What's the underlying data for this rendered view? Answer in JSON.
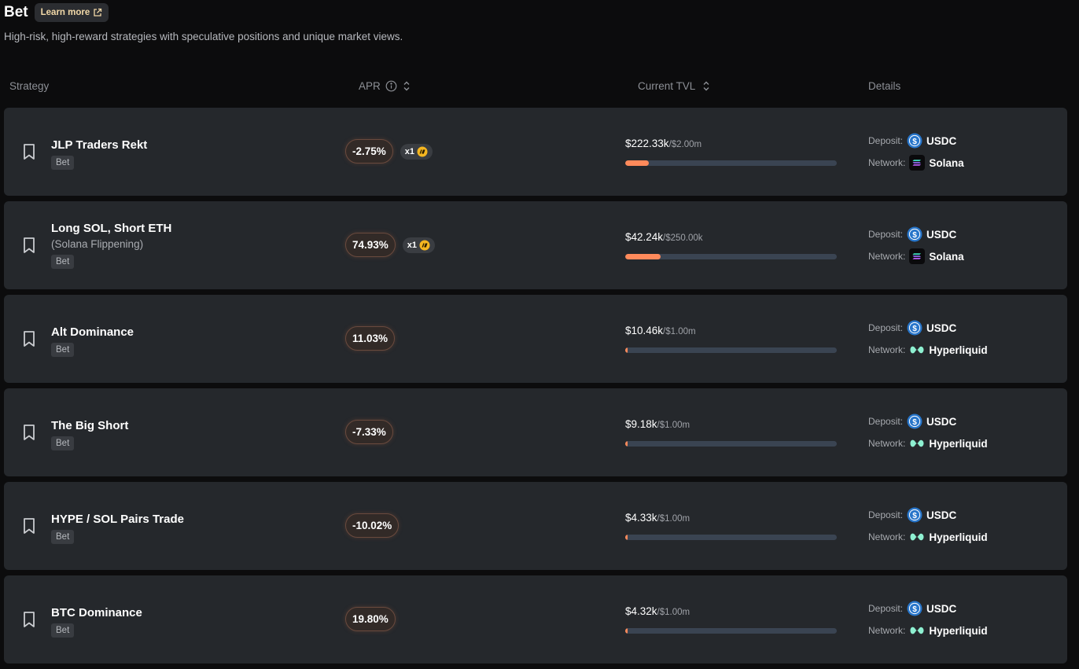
{
  "header": {
    "title": "Bet",
    "learn_more": "Learn more",
    "subtitle": "High-risk, high-reward strategies with speculative positions and unique market views."
  },
  "columns": {
    "strategy": "Strategy",
    "apr": "APR",
    "tvl": "Current TVL",
    "details": "Details"
  },
  "labels": {
    "deposit": "Deposit:",
    "network": "Network:"
  },
  "colors": {
    "accent": "#ff8a5b",
    "usdc": "#2775ca",
    "hyperliquid": "#8ef0d1"
  },
  "strategies": [
    {
      "name": "JLP Traders Rekt",
      "sub": "",
      "tag": "Bet",
      "apr": "-2.75%",
      "boost": "x1",
      "tvl": "$222.33k",
      "cap": "/$2.00m",
      "fill": 0.111,
      "deposit": "USDC",
      "network": "Solana"
    },
    {
      "name": "Long SOL, Short ETH",
      "sub": "(Solana Flippening)",
      "tag": "Bet",
      "apr": "74.93%",
      "boost": "x1",
      "tvl": "$42.24k",
      "cap": "/$250.00k",
      "fill": 0.169,
      "deposit": "USDC",
      "network": "Solana"
    },
    {
      "name": "Alt Dominance",
      "sub": "",
      "tag": "Bet",
      "apr": "11.03%",
      "boost": "",
      "tvl": "$10.46k",
      "cap": "/$1.00m",
      "fill": 0.0105,
      "deposit": "USDC",
      "network": "Hyperliquid"
    },
    {
      "name": "The Big Short",
      "sub": "",
      "tag": "Bet",
      "apr": "-7.33%",
      "boost": "",
      "tvl": "$9.18k",
      "cap": "/$1.00m",
      "fill": 0.0092,
      "deposit": "USDC",
      "network": "Hyperliquid"
    },
    {
      "name": "HYPE / SOL Pairs Trade",
      "sub": "",
      "tag": "Bet",
      "apr": "-10.02%",
      "boost": "",
      "tvl": "$4.33k",
      "cap": "/$1.00m",
      "fill": 0.0043,
      "deposit": "USDC",
      "network": "Hyperliquid"
    },
    {
      "name": "BTC Dominance",
      "sub": "",
      "tag": "Bet",
      "apr": "19.80%",
      "boost": "",
      "tvl": "$4.32k",
      "cap": "/$1.00m",
      "fill": 0.0043,
      "deposit": "USDC",
      "network": "Hyperliquid"
    }
  ]
}
